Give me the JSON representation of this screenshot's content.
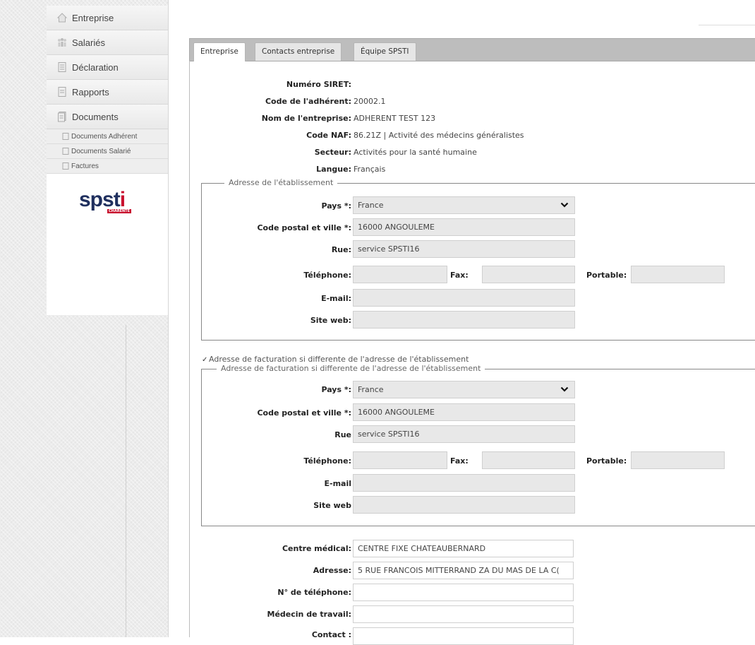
{
  "sidebar": {
    "items": [
      {
        "label": "Entreprise"
      },
      {
        "label": "Salariés"
      },
      {
        "label": "Déclaration"
      },
      {
        "label": "Rapports"
      },
      {
        "label": "Documents"
      }
    ],
    "sub_items": [
      {
        "label": "Documents Adhérent"
      },
      {
        "label": "Documents Salarié"
      },
      {
        "label": "Factures"
      }
    ],
    "logo": {
      "text_main": "spst",
      "text_i": "i",
      "sub": "CHARENTE"
    }
  },
  "tabs": [
    {
      "label": "Entreprise"
    },
    {
      "label": "Contacts entreprise"
    },
    {
      "label": "Équipe SPSTI"
    }
  ],
  "info": {
    "siret_label": "Numéro SIRET:",
    "siret_value": "",
    "code_label": "Code de l'adhérent:",
    "code_value": "20002.1",
    "nom_label": "Nom de l'entreprise:",
    "nom_value": "ADHERENT TEST 123",
    "naf_label": "Code NAF:",
    "naf_value": "86.21Z | Activité des médecins généralistes",
    "secteur_label": "Secteur:",
    "secteur_value": "Activités pour la santé humaine",
    "langue_label": "Langue:",
    "langue_value": "Français"
  },
  "etablissement": {
    "legend": "Adresse de l'établissement",
    "pays_label": "Pays *:",
    "pays_value": "France",
    "cp_label": "Code postal et ville *:",
    "cp_value": "16000 ANGOULEME",
    "rue_label": "Rue:",
    "rue_value": "service SPSTI16",
    "tel_label": "Téléphone:",
    "tel_value": "",
    "fax_label": "Fax:",
    "fax_value": "",
    "portable_label": "Portable:",
    "portable_value": "",
    "email_label": "E-mail:",
    "email_value": "",
    "web_label": "Site web:",
    "web_value": ""
  },
  "facturation": {
    "checkbox_label": "Adresse de facturation si differente de l'adresse de l'établissement",
    "legend": "Adresse de facturation si differente de l'adresse de l'établissement",
    "pays_label": "Pays *:",
    "pays_value": "France",
    "cp_label": "Code postal et ville *:",
    "cp_value": "16000 ANGOULEME",
    "rue_label": "Rue",
    "rue_value": "service SPSTI16",
    "tel_label": "Téléphone:",
    "tel_value": "",
    "fax_label": "Fax:",
    "fax_value": "",
    "portable_label": "Portable:",
    "portable_value": "",
    "email_label": "E-mail",
    "email_value": "",
    "web_label": "Site web",
    "web_value": ""
  },
  "medical": {
    "centre_label": "Centre médical:",
    "centre_value": "CENTRE FIXE CHATEAUBERNARD",
    "adresse_label": "Adresse:",
    "adresse_value": "5 RUE FRANCOIS MITTERRAND ZA DU MAS DE LA C(",
    "tel_label": "N° de téléphone:",
    "tel_value": "",
    "medecin_label": "Médecin de travail:",
    "medecin_value": "",
    "contact_label": "Contact :",
    "contact_value": ""
  },
  "colors": {
    "logo_blue": "#1f2f5e",
    "logo_red": "#c8102e",
    "tab_bar": "#bdbdbd"
  }
}
